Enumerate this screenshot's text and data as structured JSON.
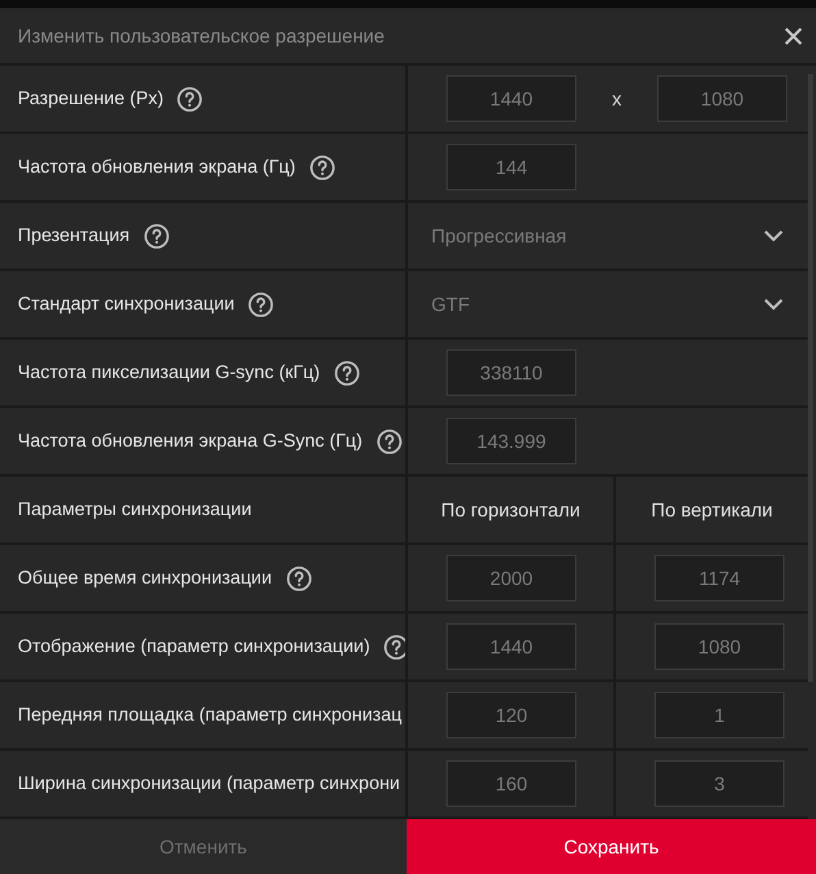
{
  "dialog": {
    "title": "Изменить пользовательское разрешение"
  },
  "rows": [
    {
      "kind": "inputs",
      "label": "Разрешение (Px)",
      "help": true,
      "values": [
        "1440",
        "1080"
      ],
      "separator": "x"
    },
    {
      "kind": "inputs",
      "label": "Частота обновления экрана (Гц)",
      "help": true,
      "values": [
        "144"
      ]
    },
    {
      "kind": "select",
      "label": "Презентация",
      "help": true,
      "value": "Прогрессивная"
    },
    {
      "kind": "select",
      "label": "Стандарт синхронизации",
      "help": true,
      "value": "GTF"
    },
    {
      "kind": "inputs",
      "label": "Частота пикселизации G-sync (кГц)",
      "help": true,
      "values": [
        "338110"
      ]
    },
    {
      "kind": "inputs",
      "label": "Частота обновления экрана G-Sync (Гц)",
      "help": true,
      "values": [
        "143.999"
      ]
    },
    {
      "kind": "header",
      "label": "Параметры синхронизации",
      "help": false,
      "columns": [
        "По горизонтали",
        "По вертикали"
      ]
    },
    {
      "kind": "pair",
      "label": "Общее время синхронизации",
      "help": true,
      "values": [
        "2000",
        "1174"
      ]
    },
    {
      "kind": "pair",
      "label": "Отображение (параметр синхронизации)",
      "help": true,
      "values": [
        "1440",
        "1080"
      ]
    },
    {
      "kind": "pair",
      "label": "Передняя площадка (параметр синхронизац",
      "help": false,
      "values": [
        "120",
        "1"
      ]
    },
    {
      "kind": "pair",
      "label": "Ширина синхронизации (параметр синхрони",
      "help": false,
      "values": [
        "160",
        "3"
      ]
    }
  ],
  "buttons": {
    "cancel": "Отменить",
    "save": "Сохранить"
  }
}
